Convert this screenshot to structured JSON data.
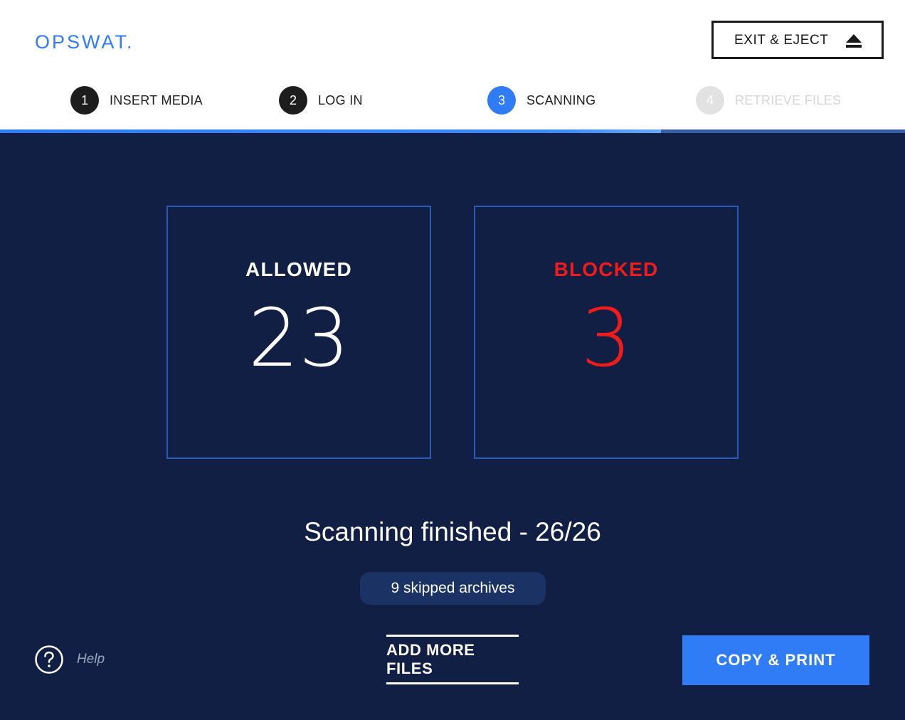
{
  "header": {
    "logo": "OPSWAT.",
    "exit_button": {
      "label": "EXIT & EJECT",
      "icon": "eject-icon"
    }
  },
  "steps": [
    {
      "number": "1",
      "label": "INSERT MEDIA",
      "state": "done"
    },
    {
      "number": "2",
      "label": "LOG IN",
      "state": "done"
    },
    {
      "number": "3",
      "label": "SCANNING",
      "state": "active"
    },
    {
      "number": "4",
      "label": "RETRIEVE FILES",
      "state": "pending"
    }
  ],
  "progress": {
    "fraction": 0.73
  },
  "results": {
    "allowed": {
      "label": "ALLOWED",
      "count": "23"
    },
    "blocked": {
      "label": "BLOCKED",
      "count": "3"
    }
  },
  "status": {
    "message": "Scanning finished - 26/26",
    "skipped": "9 skipped archives"
  },
  "footer": {
    "help_label": "Help",
    "help_icon": "question-circle-icon",
    "add_more_label": "ADD MORE FILES",
    "copy_print_label": "COPY & PRINT"
  },
  "colors": {
    "accent": "#2f7cf6",
    "background": "#121f45",
    "blocked": "#ef1c1c"
  }
}
